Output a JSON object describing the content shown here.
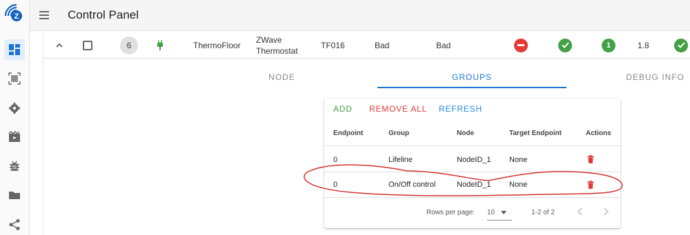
{
  "app": {
    "title": "Control Panel"
  },
  "sidebar": {
    "items": [
      {
        "name": "dashboard",
        "icon": "dashboard-icon"
      },
      {
        "name": "qr-scanner",
        "icon": "qr-scan-icon"
      },
      {
        "name": "settings",
        "icon": "gear-icon"
      },
      {
        "name": "scenes",
        "icon": "movie-icon"
      },
      {
        "name": "debug",
        "icon": "bug-icon"
      },
      {
        "name": "store",
        "icon": "folder-icon"
      },
      {
        "name": "share",
        "icon": "share-icon"
      }
    ]
  },
  "node": {
    "id": "6",
    "manufacturer": "ThermoFloor",
    "product_line1": "ZWave",
    "product_line2": "Thermostat",
    "product_code": "TF016",
    "rf_status": "Bad",
    "interview_status": "Bad",
    "firmware": "1.8",
    "colors": {
      "error": "#e53935",
      "ok": "#43a047",
      "power": "#43a047"
    }
  },
  "tabs": [
    "NODE",
    "GROUPS",
    "DEBUG INFO"
  ],
  "groups": {
    "actions": {
      "add": "ADD",
      "remove_all": "REMOVE ALL",
      "refresh": "REFRESH"
    },
    "columns": [
      "Endpoint",
      "Group",
      "Node",
      "Target Endpoint",
      "Actions"
    ],
    "rows": [
      {
        "endpoint": "0",
        "group": "Lifeline",
        "node": "NodeID_1",
        "target": "None"
      },
      {
        "endpoint": "0",
        "group": "On/Off control",
        "node": "NodeID_1",
        "target": "None"
      }
    ],
    "footer": {
      "rows_per_page_label": "Rows per page:",
      "rows_per_page": "10",
      "range": "1-2 of 2"
    }
  },
  "colors": {
    "accent": "#1976d2",
    "add": "#43a047",
    "remove": "#e53935",
    "refresh": "#1e88e5",
    "annotation": "#d32f2f"
  }
}
